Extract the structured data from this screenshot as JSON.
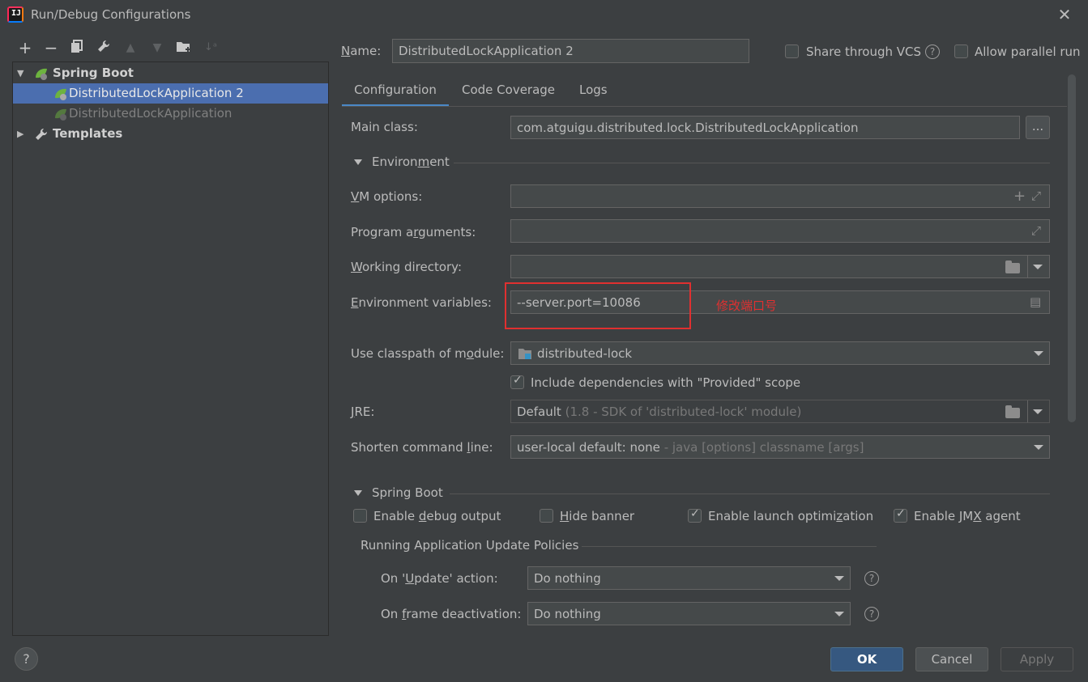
{
  "window": {
    "title": "Run/Debug Configurations",
    "app_icon_text": "IJ"
  },
  "toolbar": {
    "icons": [
      "add-icon",
      "remove-icon",
      "copy-icon",
      "wrench-icon",
      "move-up-icon",
      "move-down-icon",
      "new-folder-icon",
      "sort-icon"
    ]
  },
  "tree": {
    "spring_boot_label": "Spring Boot",
    "items": [
      {
        "label": "DistributedLockApplication 2",
        "selected": true
      },
      {
        "label": "DistributedLockApplication",
        "selected": false
      }
    ],
    "templates_label": "Templates"
  },
  "header": {
    "name_label": "Name:",
    "name_value": "DistributedLockApplication 2",
    "share_vcs_label": "Share through VCS",
    "share_vcs_checked": false,
    "allow_parallel_label": "Allow parallel run",
    "allow_parallel_checked": false
  },
  "tabs": [
    {
      "label": "Configuration",
      "active": true
    },
    {
      "label": "Code Coverage",
      "active": false
    },
    {
      "label": "Logs",
      "active": false
    }
  ],
  "form": {
    "main_class_label": "Main class:",
    "main_class_value": "com.atguigu.distributed.lock.DistributedLockApplication",
    "browse_label": "...",
    "environment_header": "Environment",
    "vm_options_label": "VM options:",
    "vm_options_value": "",
    "program_args_label": "Program arguments:",
    "program_args_value": "",
    "working_dir_label": "Working directory:",
    "working_dir_value": "",
    "env_vars_label": "Environment variables:",
    "env_vars_value": "--server.port=10086",
    "annotation": "修改端口号",
    "classpath_label": "Use classpath of module:",
    "classpath_value": "distributed-lock",
    "include_deps_label": "Include dependencies with \"Provided\" scope",
    "include_deps_checked": true,
    "jre_label": "JRE:",
    "jre_value": "Default",
    "jre_hint": "(1.8 - SDK of 'distributed-lock' module)",
    "shorten_label": "Shorten command line:",
    "shorten_value": "user-local default: none",
    "shorten_hint": "- java [options] classname [args]"
  },
  "spring_boot": {
    "header": "Spring Boot",
    "options": [
      {
        "label": "Enable debug output",
        "checked": false
      },
      {
        "label": "Hide banner",
        "checked": false
      },
      {
        "label": "Enable launch optimization",
        "checked": true
      },
      {
        "label": "Enable JMX agent",
        "checked": true
      }
    ],
    "policies_header": "Running Application Update Policies",
    "update_action_label": "On 'Update' action:",
    "update_action_value": "Do nothing",
    "frame_deactivation_label": "On frame deactivation:",
    "frame_deactivation_value": "Do nothing"
  },
  "footer": {
    "help_label": "?",
    "ok_label": "OK",
    "cancel_label": "Cancel",
    "apply_label": "Apply"
  },
  "colors": {
    "background": "#3c3f41",
    "selection": "#4b6eaf",
    "accent": "#4a88c7",
    "annotation_red": "#e03030",
    "primary_button": "#365880"
  }
}
